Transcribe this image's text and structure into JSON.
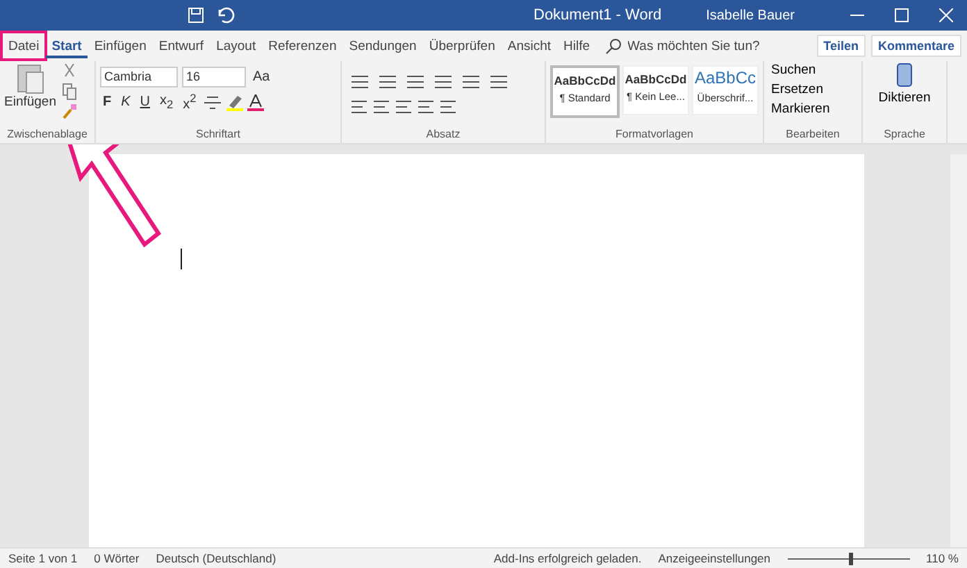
{
  "title_bar": {
    "document_title": "Dokument1  -  Word",
    "user": "Isabelle Bauer"
  },
  "tabs": [
    {
      "label": "Datei",
      "selected": false,
      "highlighted": true
    },
    {
      "label": "Start",
      "selected": true,
      "highlighted": false
    },
    {
      "label": "Einfügen",
      "selected": false,
      "highlighted": false
    },
    {
      "label": "Entwurf",
      "selected": false,
      "highlighted": false
    },
    {
      "label": "Layout",
      "selected": false,
      "highlighted": false
    },
    {
      "label": "Referenzen",
      "selected": false,
      "highlighted": false
    },
    {
      "label": "Sendungen",
      "selected": false,
      "highlighted": false
    },
    {
      "label": "Überprüfen",
      "selected": false,
      "highlighted": false
    },
    {
      "label": "Ansicht",
      "selected": false,
      "highlighted": false
    },
    {
      "label": "Hilfe",
      "selected": false,
      "highlighted": false
    }
  ],
  "tell_me": {
    "placeholder": "Was möchten Sie tun?"
  },
  "share_button": "Teilen",
  "comments_button": "Kommentare",
  "clipboard": {
    "paste": "Einfügen",
    "group": "Zwischenablage"
  },
  "font": {
    "name": "Cambria",
    "size": "16",
    "case_button": "Aa",
    "format_buttons": [
      "F",
      "K",
      "U",
      "x$_{2}$",
      "x$^{2}$"
    ],
    "group": "Schriftart"
  },
  "paragraph": {
    "group": "Absatz"
  },
  "styles": {
    "group": "Formatvorlagen",
    "items": [
      {
        "preview": "AaBbCcDd",
        "name": "¶ Standard",
        "selected": true,
        "kind": "normal"
      },
      {
        "preview": "AaBbCcDd",
        "name": "¶ Kein Lee...",
        "selected": false,
        "kind": "normal"
      },
      {
        "preview": "AaBbCc",
        "name": "Überschrif...",
        "selected": false,
        "kind": "heading"
      }
    ]
  },
  "editing": {
    "group": "Bearbeiten",
    "items": [
      "Suchen",
      "Ersetzen",
      "Markieren"
    ]
  },
  "voice": {
    "label": "Diktieren",
    "group": "Sprache"
  },
  "status_bar": {
    "items": [
      "Seite 1 von 1",
      "0 Wörter",
      "Deutsch (Deutschland)"
    ],
    "message": "Add-Ins erfolgreich geladen.",
    "display_settings": "Anzeigeeinstellungen",
    "zoom": {
      "level": 0.5,
      "reading": "110 %"
    }
  }
}
